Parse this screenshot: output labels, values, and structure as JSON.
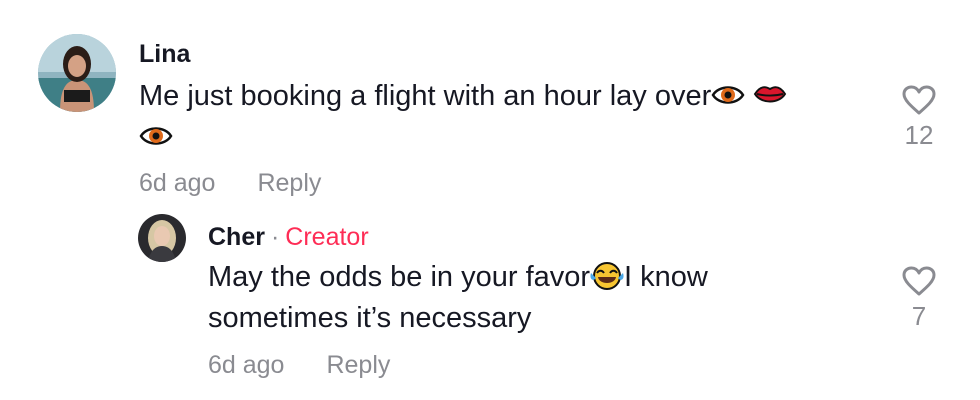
{
  "comments": [
    {
      "author": "Lina",
      "text_line1": "Me just booking a flight with an hour lay over",
      "emoji": [
        "eye-emoji",
        "lips-emoji",
        "eye-emoji"
      ],
      "time": "6d ago",
      "reply_label": "Reply",
      "like_count": "12"
    },
    {
      "author": "Cher",
      "separator": "·",
      "badge": "Creator",
      "text_part1": "May the odds be in your favor",
      "text_part2": "I know",
      "text_line2": "sometimes it’s necessary",
      "emoji": [
        "tears-of-joy-emoji"
      ],
      "time": "6d ago",
      "reply_label": "Reply",
      "like_count": "7"
    }
  ],
  "colors": {
    "text": "#161823",
    "muted": "#8a8b91",
    "creator_badge": "#fe2c55"
  }
}
